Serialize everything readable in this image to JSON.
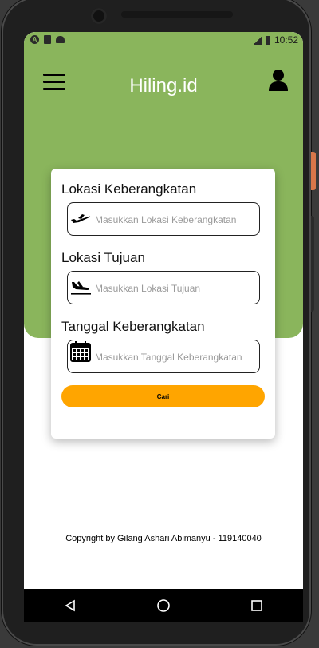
{
  "status_bar": {
    "time": "10:52",
    "left_icon_letter": "A"
  },
  "header": {
    "title": "Hiling.id"
  },
  "form": {
    "departure": {
      "label": "Lokasi Keberangkatan",
      "placeholder": "Masukkan Lokasi Keberangkatan",
      "icon": "airplane-takeoff-icon"
    },
    "destination": {
      "label": "Lokasi Tujuan",
      "placeholder": "Masukkan Lokasi Tujuan",
      "icon": "airplane-landing-icon"
    },
    "date": {
      "label": "Tanggal Keberangkatan",
      "placeholder": "Masukkan Tanggal Keberangkatan",
      "icon": "calendar-icon"
    },
    "submit_label": "Cari"
  },
  "footer": {
    "copyright": "Copyright by Gilang Ashari Abimanyu - 119140040"
  },
  "colors": {
    "header_green": "#8ab55c",
    "button_orange": "#ffa500",
    "background": "#ffffff"
  }
}
